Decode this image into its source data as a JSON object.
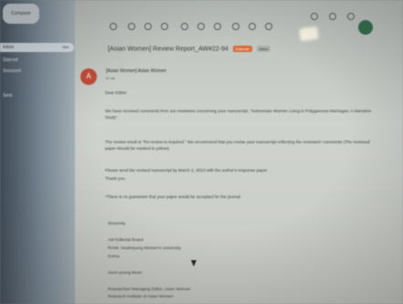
{
  "sidebar": {
    "compose_label": "Compose",
    "items": [
      {
        "label": "Inbox",
        "count": "999"
      },
      {
        "label": "Starred",
        "count": ""
      },
      {
        "label": "Snoozed",
        "count": ""
      },
      {
        "label": "Sent",
        "count": ""
      }
    ]
  },
  "email": {
    "subject": "[Asian Women] Review Report_AW#22-94",
    "badge_external": "External",
    "badge_inbox": "Inbox",
    "sender": "[Asian Women] Asian Women",
    "to": "to me",
    "greeting": "Dear Editor,",
    "para1": "We have received comments from our reviewers concerning your manuscript, \"Indonesian Women Living in Polygamous Marriages: A Narrative Study\".",
    "para2": "The review result is \"Re-review is required.\" We recommend that you revise your manuscript reflecting the reviewers' comments (The reviewed paper should be marked in yellow).",
    "para3": "Please send the revised manuscript by March 2, 2023 with the author's response paper.",
    "thanks": "Thank you.",
    "para4": "*There is no guarantee that your paper would be accepted for the journal.",
    "signoff": "Sincerely,",
    "sig1": "AW Editorial Board",
    "sig2": "RIAW, Sookmyung Women's University",
    "sig3": "Korea,",
    "sig4": "Seon-young Moon",
    "sig5": "Researcher/ Managing Editor, Asian Women",
    "sig6": "Research Institute of Asian Women"
  },
  "colors": {
    "accent_avatar": "#c14b38",
    "badge_external": "#d96b3a"
  }
}
